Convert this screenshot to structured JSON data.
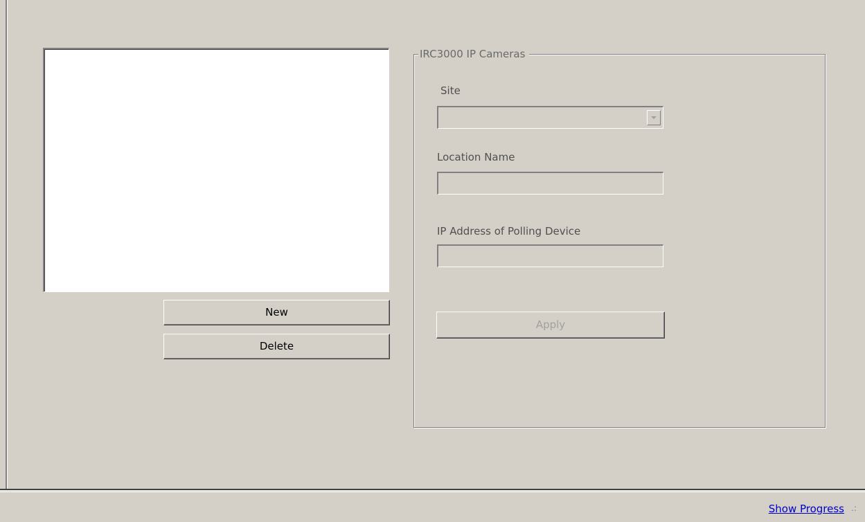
{
  "list_panel": {
    "items": [],
    "new_label": "New",
    "delete_label": "Delete"
  },
  "camera_group": {
    "title": "IRC3000 IP Cameras",
    "site_label": "Site",
    "site_value": "",
    "location_label": "Location Name",
    "location_value": "",
    "ip_label": "IP Address of Polling Device",
    "ip_value": "",
    "apply_label": "Apply"
  },
  "status_bar": {
    "show_progress_label": "Show Progress"
  }
}
